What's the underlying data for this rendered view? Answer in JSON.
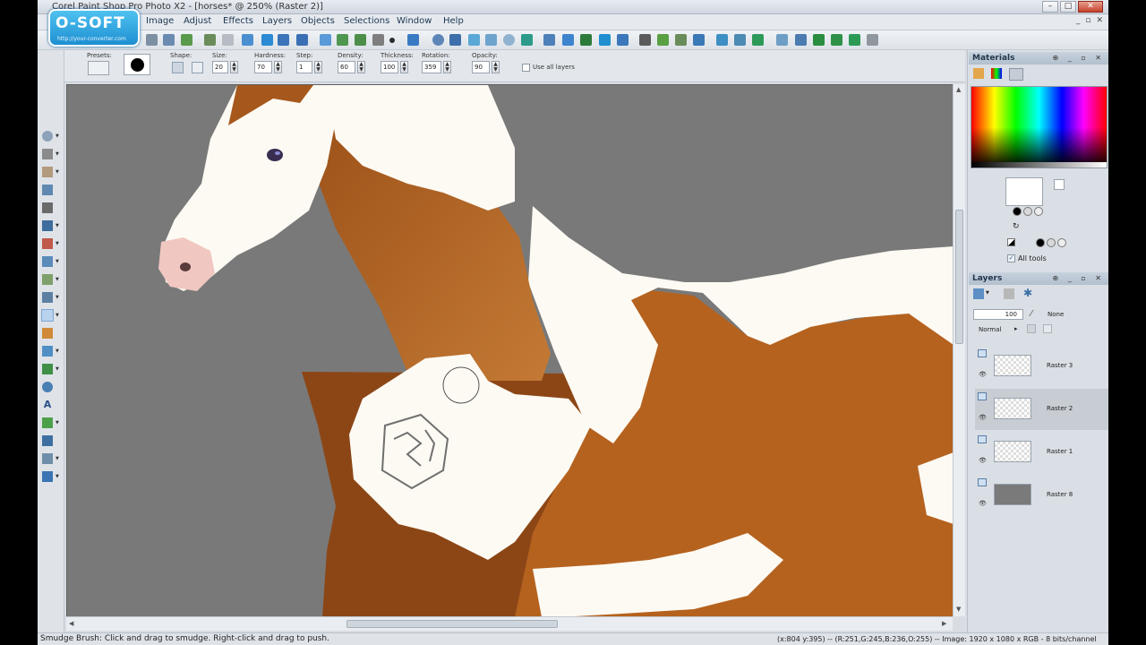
{
  "window": {
    "title": "Corel Paint Shop Pro Photo X2 - [horses* @ 250% (Raster 2)]",
    "controls": [
      "–",
      "□",
      "✕"
    ]
  },
  "watermark": {
    "brand": "O-SOFT",
    "tagline": "http://your-converter.com"
  },
  "menu": [
    "Image",
    "Adjust",
    "Effects",
    "Layers",
    "Objects",
    "Selections",
    "Window",
    "Help"
  ],
  "mdi_controls": [
    "_",
    "▫",
    "✕"
  ],
  "tool_options": {
    "presets_label": "Presets:",
    "shape_label": "Shape:",
    "size_label": "Size:",
    "size_value": "20",
    "hardness_label": "Hardness:",
    "hardness_value": "70",
    "step_label": "Step:",
    "step_value": "1",
    "density_label": "Density:",
    "density_value": "60",
    "thickness_label": "Thickness:",
    "thickness_value": "100",
    "rotation_label": "Rotation:",
    "rotation_value": "359",
    "opacity_label": "Opacity:",
    "opacity_value": "90",
    "use_all_layers": "Use all layers"
  },
  "materials": {
    "title": "Materials",
    "foreground_color": "#ffffff",
    "background_color": "#ffffff",
    "all_tools_label": "All tools",
    "all_tools_checked": true
  },
  "layers": {
    "title": "Layers",
    "opacity": "100",
    "blend_mode": "Normal",
    "mask": "None",
    "items": [
      {
        "name": "Raster 3",
        "selected": false
      },
      {
        "name": "Raster 2",
        "selected": true
      },
      {
        "name": "Raster 1",
        "selected": false
      },
      {
        "name": "Raster 8",
        "selected": false
      }
    ]
  },
  "status": {
    "hint": "Smudge Brush: Click and drag to smudge. Right-click and drag to push.",
    "info": "(x:804 y:395) -- (R:251,G:245,B:236,O:255) -- Image: 1920 x 1080 x RGB - 8 bits/channel"
  },
  "colors": {
    "horse_brown": "#b5621f",
    "horse_white": "#fdfaf3",
    "canvas_gray": "#797979",
    "accent": "#1e8fd2"
  }
}
